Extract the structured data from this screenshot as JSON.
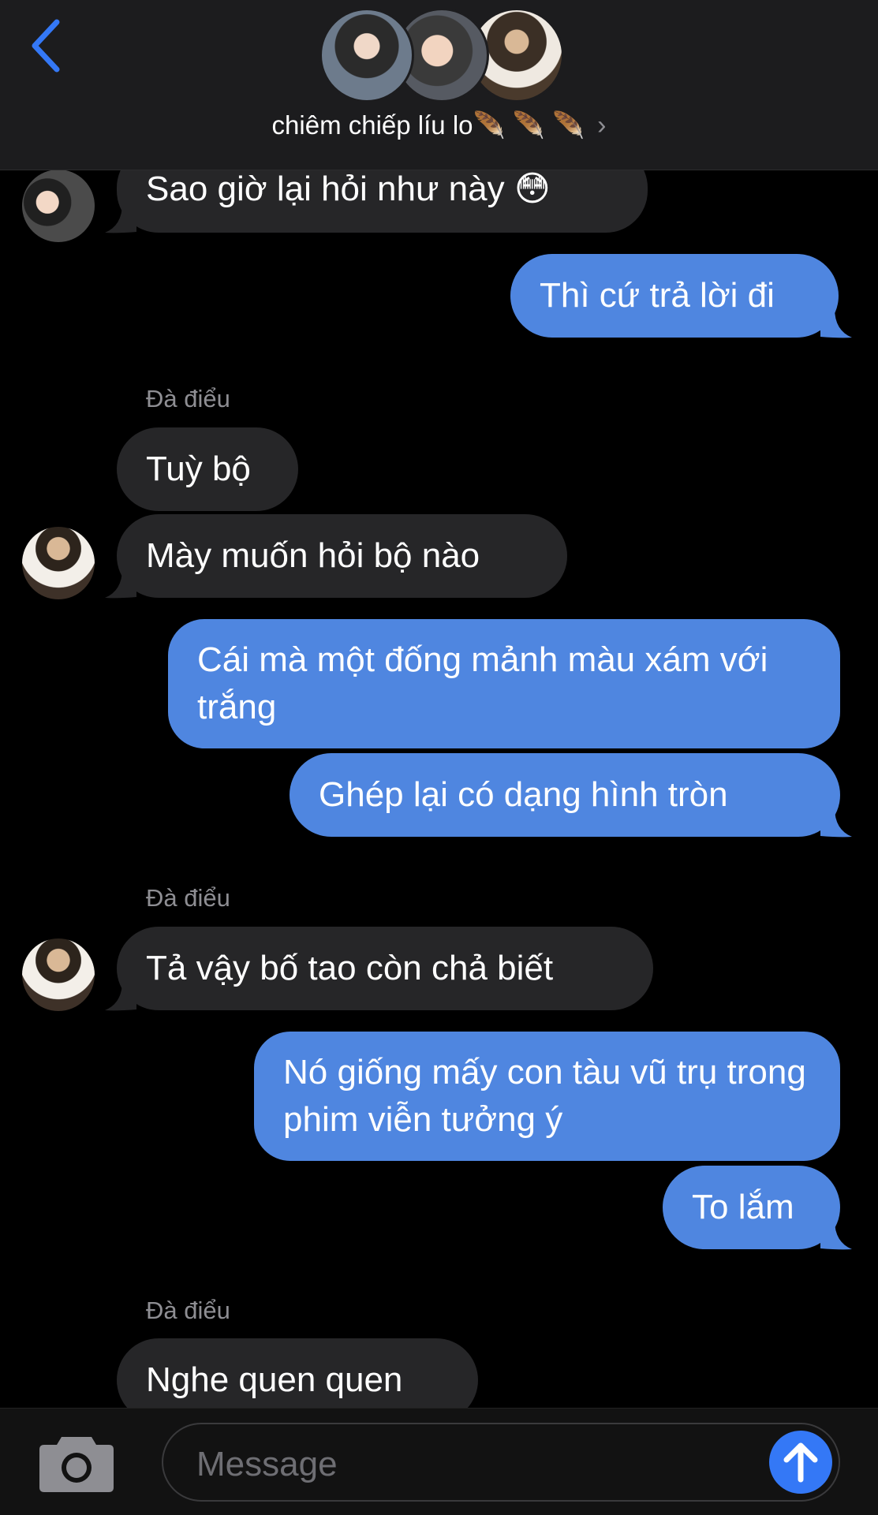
{
  "header": {
    "group_name": "chiêm chiếp líu lo",
    "group_name_suffix": "🪶 🪶 🪶",
    "chevron": "›"
  },
  "messages": [
    {
      "id": "m1",
      "direction": "incoming",
      "text": "Sao giờ lại hỏi như này 😳",
      "avatar": "couple"
    },
    {
      "id": "m2",
      "direction": "outgoing",
      "text": "Thì cứ trả lời đi"
    },
    {
      "id": "m3",
      "direction": "incoming",
      "sender": "Đà điểu",
      "text": "Tuỳ bộ"
    },
    {
      "id": "m4",
      "direction": "incoming",
      "text": "Mày muốn hỏi bộ nào",
      "avatar": "guy"
    },
    {
      "id": "m5",
      "direction": "outgoing",
      "text": "Cái mà một đống mảnh màu xám với trắng"
    },
    {
      "id": "m6",
      "direction": "outgoing",
      "text": "Ghép lại có dạng hình tròn"
    },
    {
      "id": "m7",
      "direction": "incoming",
      "sender": "Đà điểu",
      "text": "Tả vậy bố tao còn chả biết",
      "avatar": "guy"
    },
    {
      "id": "m8",
      "direction": "outgoing",
      "text": "Nó giống mấy con tàu vũ trụ trong phim viễn tưởng ý"
    },
    {
      "id": "m9",
      "direction": "outgoing",
      "text": "To lắm"
    },
    {
      "id": "m10",
      "direction": "incoming",
      "sender": "Đà điểu",
      "text": "Nghe quen quen"
    }
  ],
  "input": {
    "placeholder": "Message"
  },
  "colors": {
    "incoming_bubble": "#262628",
    "outgoing_bubble": "#4f86e0",
    "accent": "#3478f6"
  },
  "icons": {
    "back": "chevron-left-icon",
    "camera": "camera-icon",
    "send": "arrow-up-icon"
  }
}
